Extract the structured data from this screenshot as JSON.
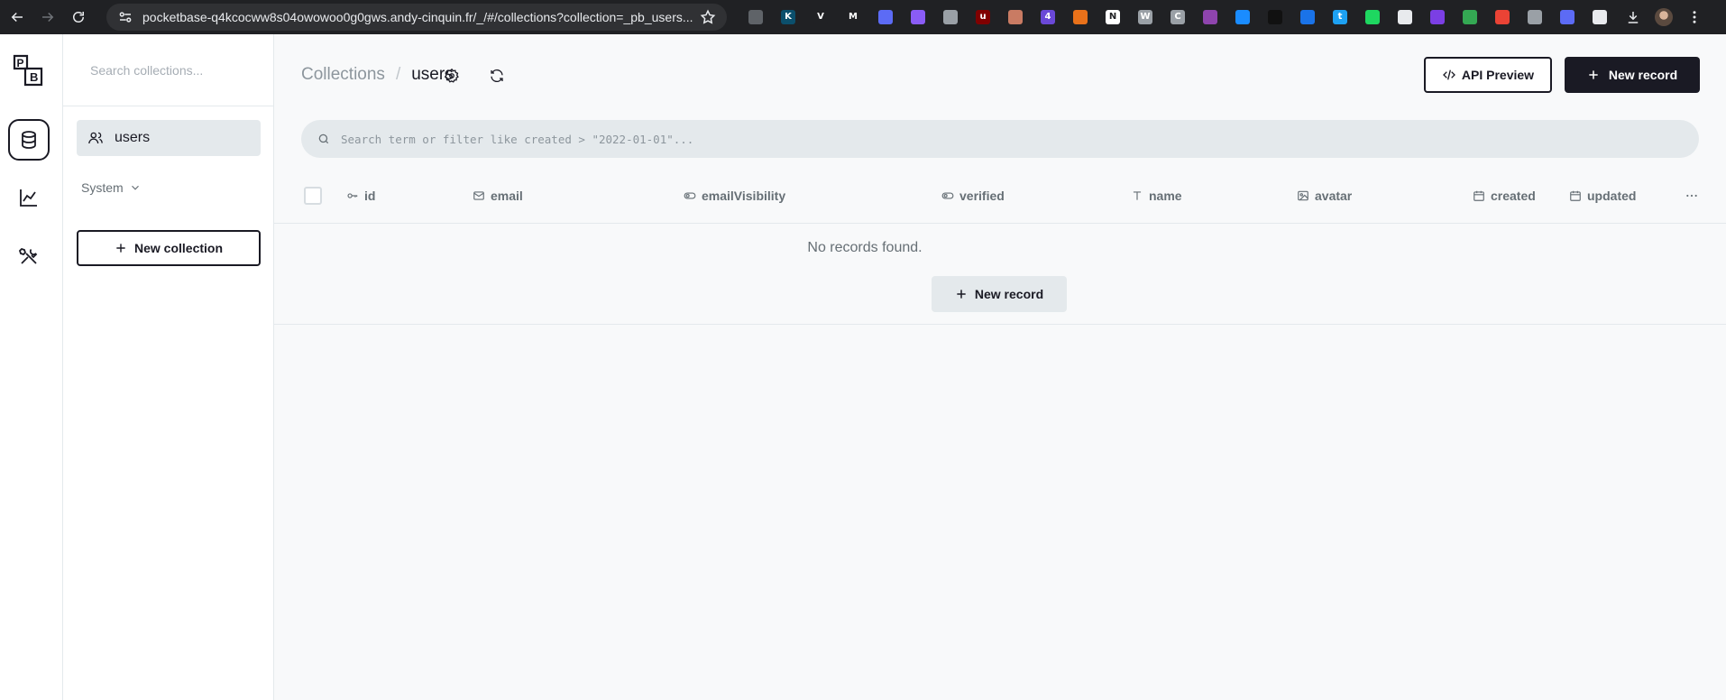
{
  "browser": {
    "url": "pocketbase-q4kcocww8s04owowoo0g0gws.andy-cinquin.fr/_/#/collections?collection=_pb_users...",
    "extensions": [
      {
        "name": "history-ext-icon",
        "color": "#5f6368",
        "glyph": ""
      },
      {
        "name": "kollect-ext-icon",
        "color": "#0b4f6c",
        "glyph": "K"
      },
      {
        "name": "v-ext-icon",
        "color": "#202124",
        "glyph": "V"
      },
      {
        "name": "m-ext-icon",
        "color": "#202124",
        "glyph": "M"
      },
      {
        "name": "hex-ext-icon",
        "color": "#5c6bf5",
        "glyph": ""
      },
      {
        "name": "gear-purple-ext-icon",
        "color": "#8a5cf6",
        "glyph": ""
      },
      {
        "name": "bars-ext-icon",
        "color": "#9aa0a6",
        "glyph": ""
      },
      {
        "name": "ublock-ext-icon",
        "color": "#800000",
        "glyph": "u"
      },
      {
        "name": "face-ext-icon",
        "color": "#c97b63",
        "glyph": ""
      },
      {
        "name": "badge-ext-icon",
        "color": "#6a48d7",
        "glyph": "4"
      },
      {
        "name": "fox-ext-icon",
        "color": "#e8711a",
        "glyph": ""
      },
      {
        "name": "notion-ext-icon",
        "color": "#ffffff",
        "glyph": "N"
      },
      {
        "name": "wordpress-ext-icon",
        "color": "#9aa0a6",
        "glyph": "W"
      },
      {
        "name": "ci-ext-icon",
        "color": "#9aa0a6",
        "glyph": "C"
      },
      {
        "name": "triangle-ext-icon",
        "color": "#8e44ad",
        "glyph": ""
      },
      {
        "name": "shazam-ext-icon",
        "color": "#1a8cff",
        "glyph": ""
      },
      {
        "name": "dark-ext-icon",
        "color": "#111111",
        "glyph": ""
      },
      {
        "name": "window-ext-icon",
        "color": "#1a73e8",
        "glyph": ""
      },
      {
        "name": "t-ext-icon",
        "color": "#1da1f2",
        "glyph": "t"
      },
      {
        "name": "green-dot-ext-icon",
        "color": "#1ed760",
        "glyph": ""
      },
      {
        "name": "doc-ext-icon",
        "color": "#e8eaed",
        "glyph": ""
      },
      {
        "name": "check-purple-ext-icon",
        "color": "#7b3fe4",
        "glyph": ""
      },
      {
        "name": "chart-ext-icon",
        "color": "#34a853",
        "glyph": ""
      },
      {
        "name": "code-ext-icon",
        "color": "#ea4335",
        "glyph": ""
      },
      {
        "name": "settings-ext-icon",
        "color": "#9aa0a6",
        "glyph": ""
      },
      {
        "name": "sun-ext-icon",
        "color": "#5c6bf5",
        "glyph": ""
      },
      {
        "name": "puzzle-ext-icon",
        "color": "#e8eaed",
        "glyph": ""
      }
    ]
  },
  "sidebar": {
    "search_placeholder": "Search collections...",
    "collections": [
      {
        "label": "users"
      }
    ],
    "system_label": "System",
    "new_collection_label": "New collection"
  },
  "header": {
    "breadcrumb_parent": "Collections",
    "breadcrumb_separator": "/",
    "breadcrumb_current": "users",
    "api_preview_label": "API Preview",
    "new_record_label": "New record"
  },
  "search": {
    "placeholder": "Search term or filter like created > \"2022-01-01\"..."
  },
  "table": {
    "columns": [
      {
        "label": "id",
        "icon": "key-icon"
      },
      {
        "label": "email",
        "icon": "mail-icon"
      },
      {
        "label": "emailVisibility",
        "icon": "toggle-icon"
      },
      {
        "label": "verified",
        "icon": "toggle-icon"
      },
      {
        "label": "name",
        "icon": "text-icon"
      },
      {
        "label": "avatar",
        "icon": "image-icon"
      },
      {
        "label": "created",
        "icon": "calendar-icon"
      },
      {
        "label": "updated",
        "icon": "calendar-icon"
      }
    ],
    "empty_message": "No records found.",
    "empty_button_label": "New record"
  }
}
